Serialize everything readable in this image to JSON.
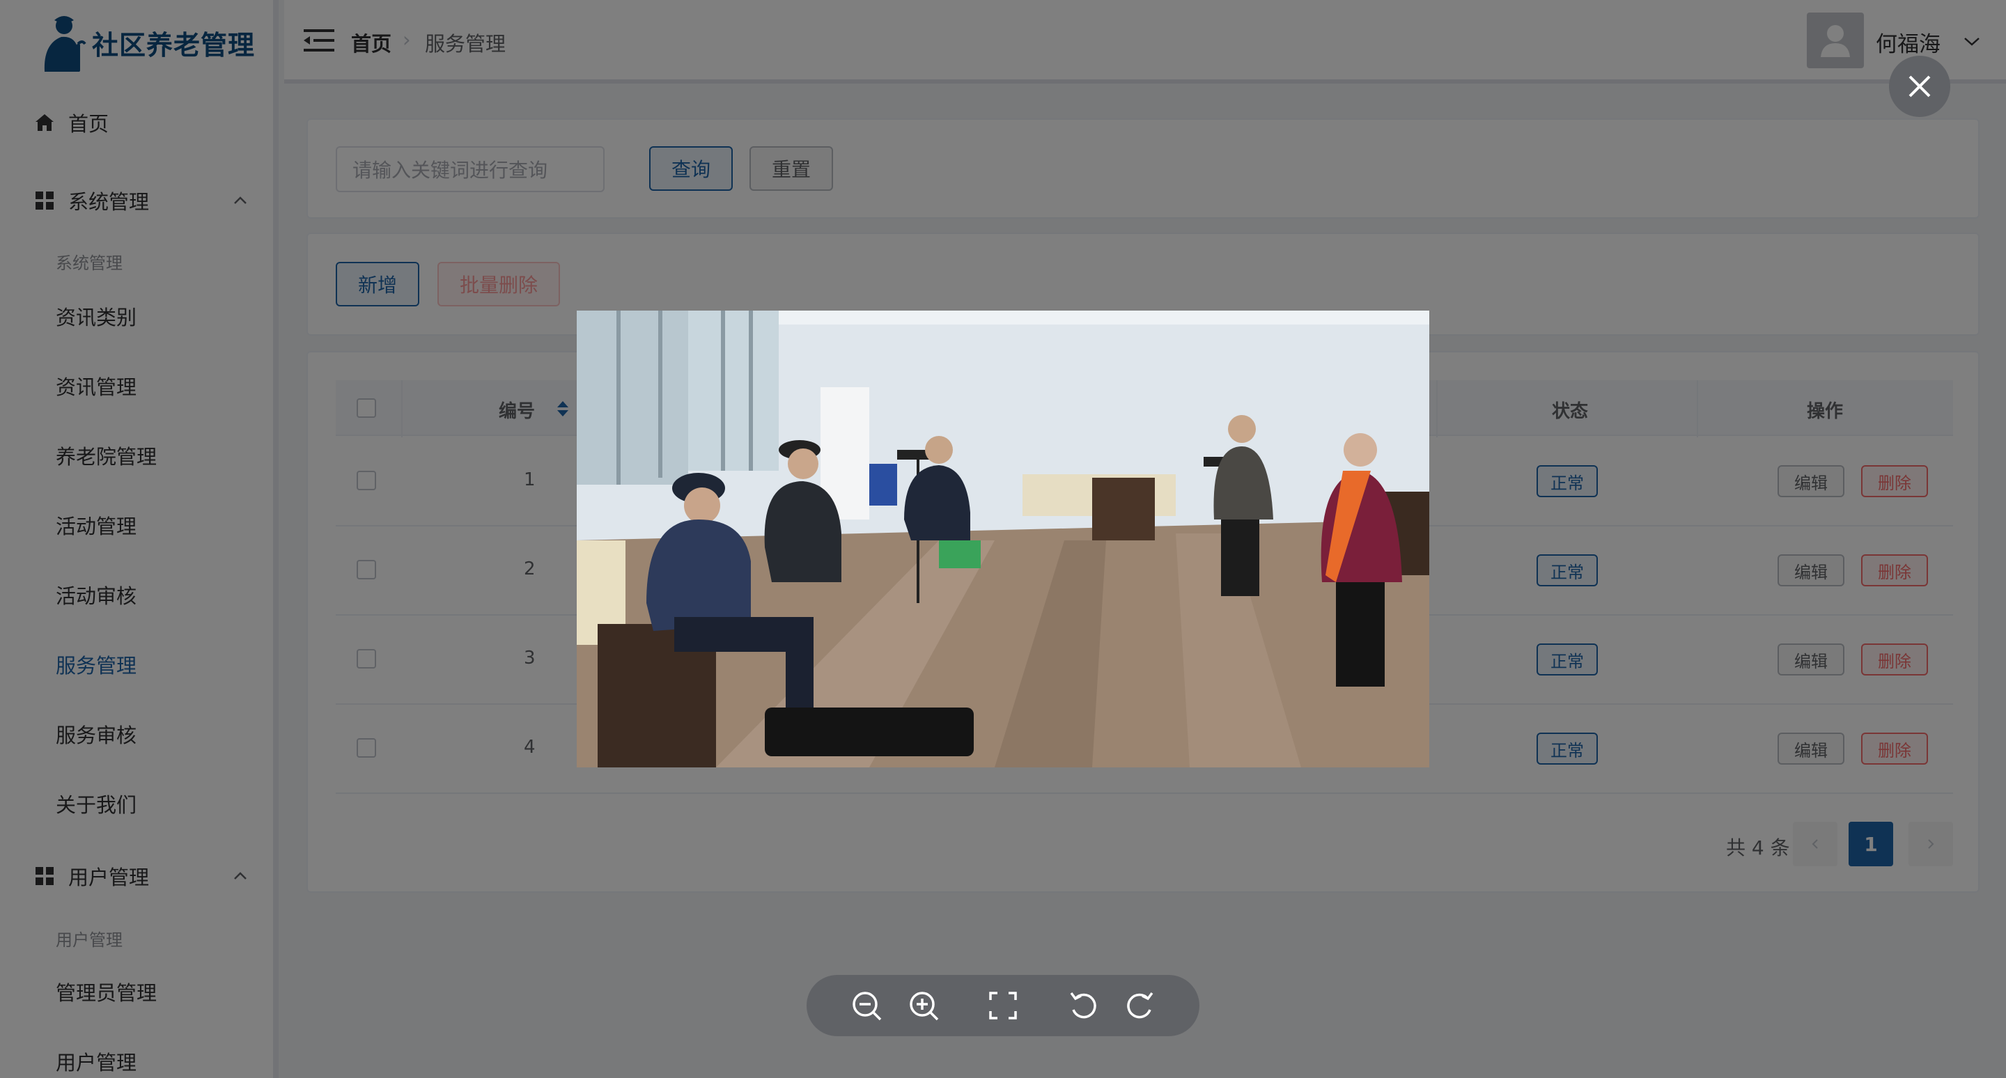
{
  "app": {
    "logo_text": "社区养老管理"
  },
  "sidebar": {
    "home": "首页",
    "system_group": "系统管理",
    "system_sub_title": "系统管理",
    "system_items": [
      "资讯类别",
      "资讯管理",
      "养老院管理",
      "活动管理",
      "活动审核",
      "服务管理",
      "服务审核",
      "关于我们"
    ],
    "user_group": "用户管理",
    "user_sub_title": "用户管理",
    "user_items": [
      "管理员管理",
      "用户管理"
    ],
    "active_item": "服务管理"
  },
  "header": {
    "breadcrumb_home": "首页",
    "breadcrumb_current": "服务管理",
    "user_name": "何福海"
  },
  "search": {
    "placeholder": "请输入关键词进行查询",
    "query_label": "查询",
    "reset_label": "重置"
  },
  "actions": {
    "add_label": "新增",
    "batch_delete_label": "批量删除"
  },
  "table": {
    "columns": {
      "id": "编号",
      "status": "状态",
      "actions": "操作"
    },
    "rows": [
      {
        "id": "1",
        "status": "正常",
        "edit": "编辑",
        "delete": "删除"
      },
      {
        "id": "2",
        "status": "正常",
        "edit": "编辑",
        "delete": "删除"
      },
      {
        "id": "3",
        "status": "正常",
        "edit": "编辑",
        "delete": "删除"
      },
      {
        "id": "4",
        "status": "正常",
        "edit": "编辑",
        "delete": "删除"
      }
    ]
  },
  "pagination": {
    "total_text": "共 4 条",
    "current_page": "1"
  },
  "colors": {
    "primary": "#1f64a8",
    "danger": "#f56c6c",
    "logo": "#0f4c81"
  },
  "viewer": {
    "toolbar_icons": [
      "zoom-out-icon",
      "zoom-in-icon",
      "fullscreen-icon",
      "rotate-left-icon",
      "rotate-right-icon"
    ],
    "close_icon": "close-icon"
  }
}
